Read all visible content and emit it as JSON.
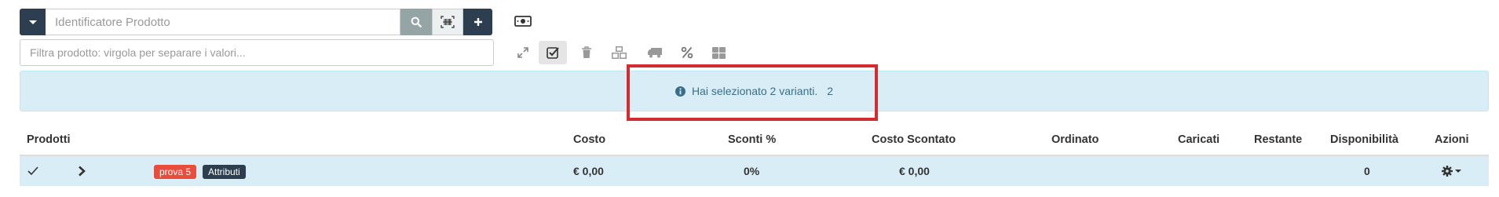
{
  "toolbar": {
    "product_id_placeholder": "Identificatore Prodotto",
    "filter_placeholder": "Filtra prodotto: virgola per separare i valori..."
  },
  "alert": {
    "message": "Hai selezionato 2 varianti.",
    "count": "2"
  },
  "table": {
    "headers": {
      "products": "Prodotti",
      "cost": "Costo",
      "discounts": "Sconti %",
      "discounted_cost": "Costo Scontato",
      "ordered": "Ordinato",
      "loaded": "Caricati",
      "remaining": "Restante",
      "availability": "Disponibilità",
      "actions": "Azioni"
    },
    "rows": [
      {
        "label_name": "prova 5",
        "label_attrs": "Attributi",
        "cost": "€ 0,00",
        "discount": "0%",
        "discounted_cost": "€ 0,00",
        "ordered": "",
        "loaded": "",
        "remaining": "",
        "availability": "0"
      }
    ]
  },
  "colors": {
    "primary_dark": "#2c3e50",
    "info_bg": "#d9edf7",
    "highlight": "#d42b30",
    "label_red": "#e74c3c"
  },
  "icons": [
    "caret-down-icon",
    "search-icon",
    "barcode-scan-icon",
    "plus-icon",
    "money-icon",
    "expand-icon",
    "check-square-icon",
    "trash-icon",
    "cubes-icon",
    "truck-icon",
    "percent-icon",
    "grid-icon",
    "info-circle-icon",
    "check-icon",
    "chevron-right-icon",
    "cog-icon"
  ]
}
